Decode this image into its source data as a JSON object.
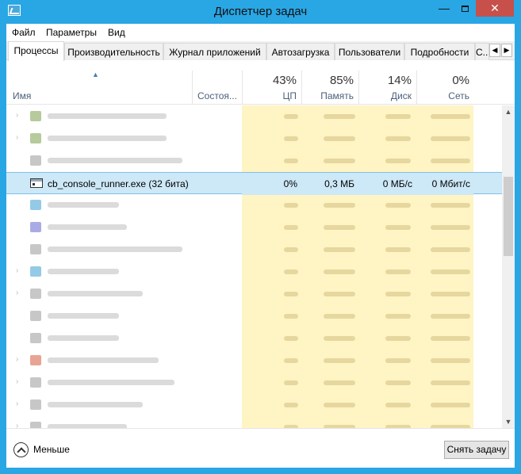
{
  "window": {
    "title": "Диспетчер задач",
    "close_glyph": "✕",
    "min_glyph": "—"
  },
  "menu": [
    "Файл",
    "Параметры",
    "Вид"
  ],
  "tabs": [
    "Процессы",
    "Производительность",
    "Журнал приложений",
    "Автозагрузка",
    "Пользователи",
    "Подробности",
    "С..."
  ],
  "header": {
    "name": "Имя",
    "status": "Состоя...",
    "cpu": {
      "pct": "43%",
      "label": "ЦП"
    },
    "memory": {
      "pct": "85%",
      "label": "Память"
    },
    "disk": {
      "pct": "14%",
      "label": "Диск"
    },
    "network": {
      "pct": "0%",
      "label": "Сеть"
    }
  },
  "selected_process": {
    "name": "cb_console_runner.exe (32 бита)",
    "cpu": "0%",
    "memory": "0,3 МБ",
    "disk": "0 МБ/с",
    "network": "0 Мбит/с"
  },
  "footer": {
    "fewer": "Меньше",
    "end_task": "Снять задачу"
  },
  "colors": {
    "titlebar": "#29a6e4",
    "close": "#c7504b",
    "selection": "#cde8f7",
    "resource_cell": "#fff4c4"
  }
}
